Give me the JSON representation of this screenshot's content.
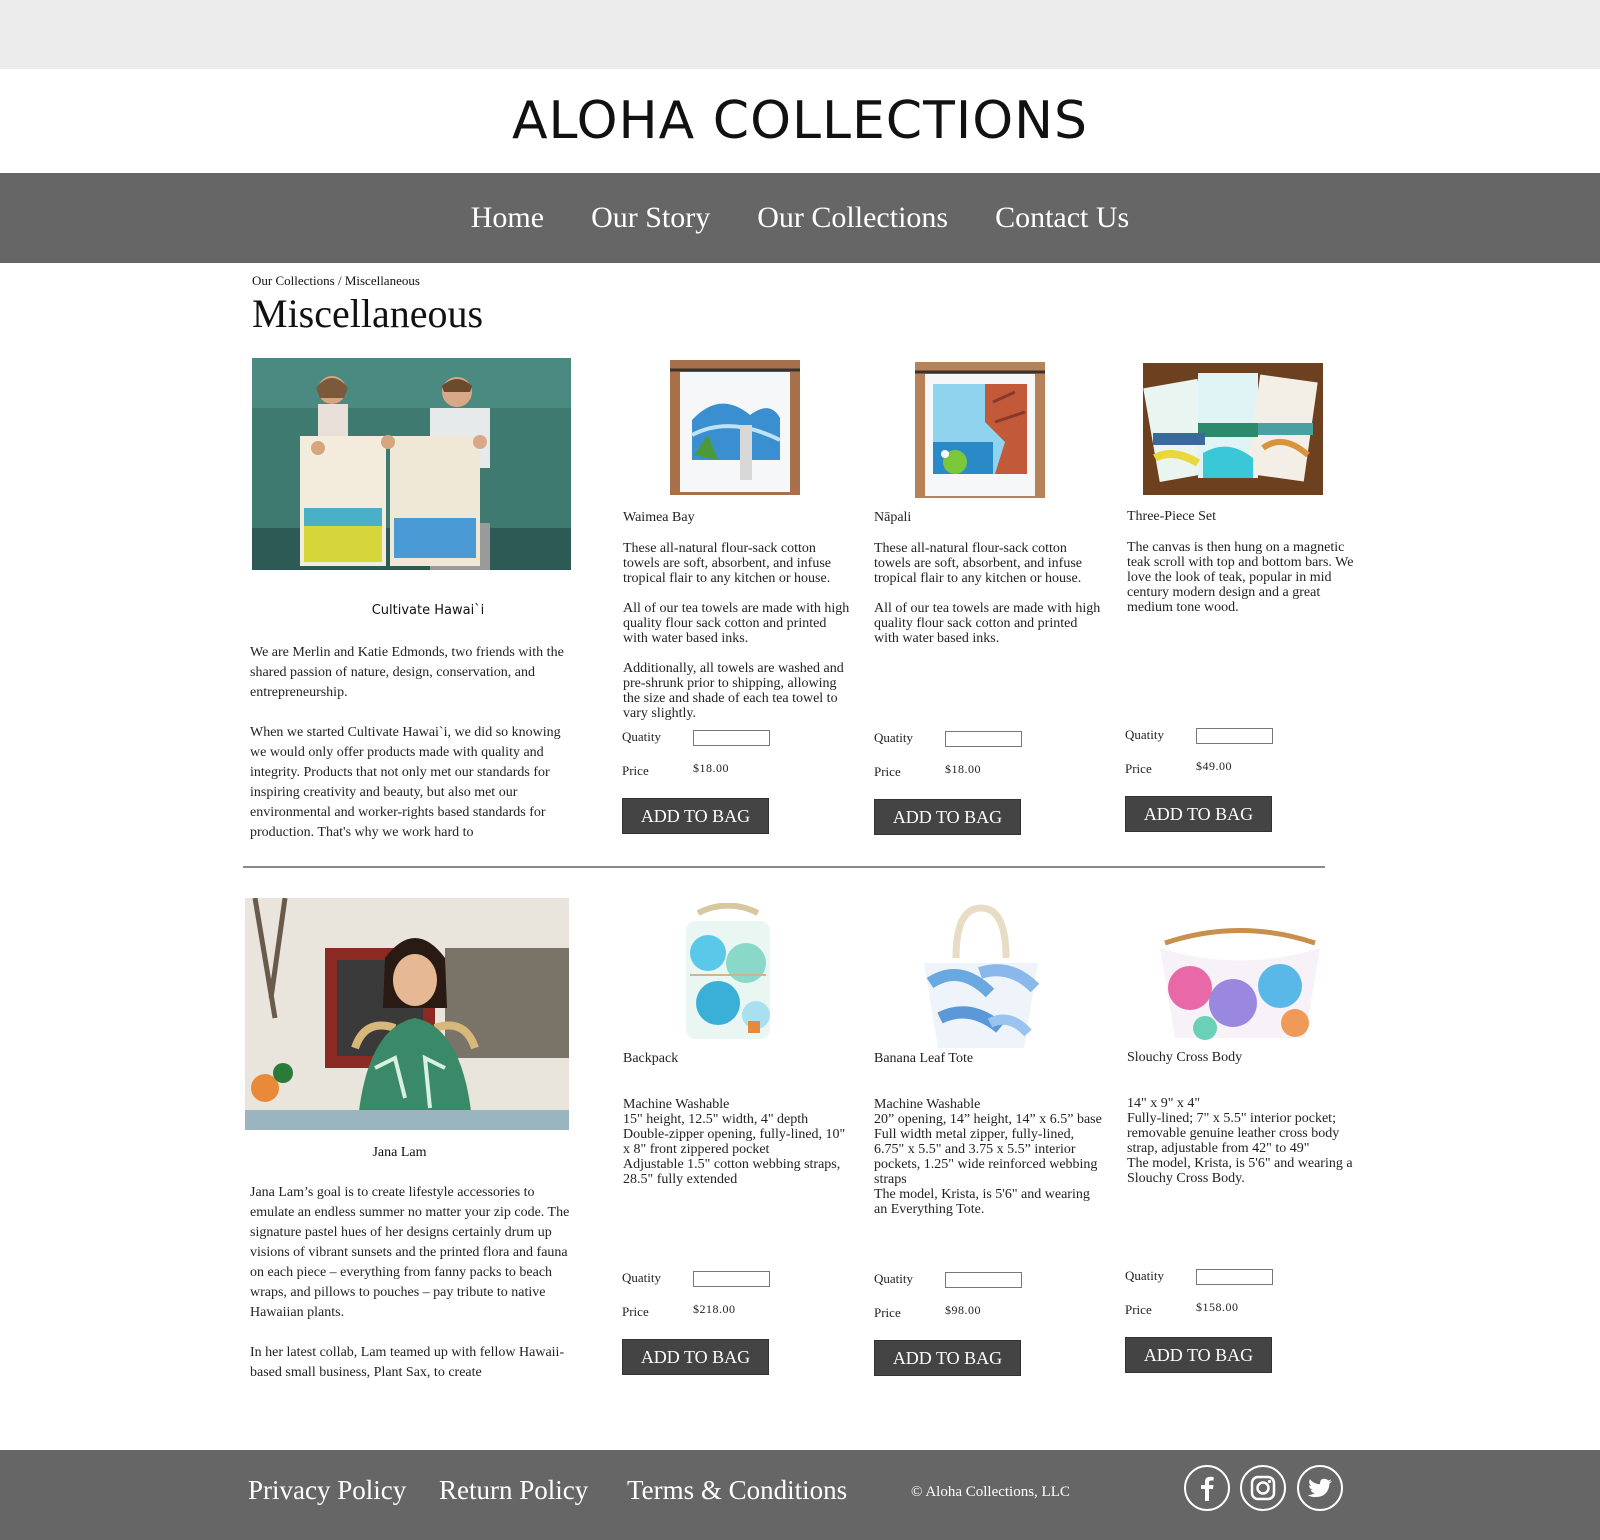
{
  "brand": {
    "logo_text": "ALOHA COLLECTIONS"
  },
  "nav": {
    "items": [
      {
        "label": "Home"
      },
      {
        "label": "Our Story"
      },
      {
        "label": "Our Collections"
      },
      {
        "label": "Contact Us"
      }
    ]
  },
  "breadcrumb": {
    "parent": "Our Collections",
    "separator": "/",
    "current": "Miscellaneous"
  },
  "page_title": "Miscellaneous",
  "sections": [
    {
      "photo_icon": "couple-holding-tea-towels-photo",
      "caption": "Cultivate Hawai`i",
      "bio": [
        "We are Merlin and Katie Edmonds, two friends with the shared passion of nature, design, conservation, and entrepreneurship.",
        "When we started Cultivate Hawai`i, we did so knowing we would only offer products made with quality and integrity. Products that not only met our standards for inspiring creativity and beauty, but also met our environmental and worker-rights based standards for production. That's why we work hard to"
      ],
      "products": [
        {
          "name": "Waimea Bay",
          "image_icon": "waimea-bay-tea-towel-image",
          "description": [
            "These all-natural flour-sack cotton towels are soft, absorbent, and infuse tropical flair to any kitchen or house.",
            "All of our tea towels are made with high quality flour sack cotton and printed with water based inks.",
            "Additionally, all towels are washed and pre-shrunk prior to shipping, allowing the size and shade of each tea towel to vary slightly."
          ],
          "qty_label": "Quatity",
          "qty_value": "",
          "price_label": "Price",
          "price": "$18.00",
          "button": "ADD TO BAG"
        },
        {
          "name": "Nāpali",
          "image_icon": "napali-tea-towel-image",
          "description": [
            "These all-natural flour-sack cotton towels are soft, absorbent, and infuse tropical flair to any kitchen or house.",
            "All of our tea towels are made with high quality flour sack cotton and printed with water based inks."
          ],
          "qty_label": "Quatity",
          "qty_value": "",
          "price_label": "Price",
          "price": "$18.00",
          "button": "ADD TO BAG"
        },
        {
          "name": "Three-Piece Set",
          "image_icon": "three-piece-set-image",
          "description": [
            "The canvas is then hung on a magnetic teak scroll with top and bottom bars.  We love the look of teak, popular in mid century modern design and a great medium tone wood."
          ],
          "qty_label": "Quatity",
          "qty_value": "",
          "price_label": "Price",
          "price": "$49.00",
          "button": "ADD TO BAG"
        }
      ]
    },
    {
      "photo_icon": "jana-lam-portrait-photo",
      "caption": "Jana Lam",
      "bio": [
        "Jana Lam’s goal is to create lifestyle accessories to emulate an endless summer no matter your zip code. The signature pastel hues of her designs certainly drum up visions of vibrant sunsets and the printed flora and fauna on each piece – everything from fanny packs to beach wraps, and pillows to pouches – pay tribute to native Hawaiian plants.",
        "In her latest collab, Lam teamed up with fellow Hawaii-based small business, Plant Sax, to create"
      ],
      "products": [
        {
          "name": "Backpack",
          "image_icon": "backpack-image",
          "description": [
            "Machine Washable\n15\" height, 12.5\" width, 4\" depth\nDouble-zipper opening, fully-lined, 10\" x 8\" front zippered pocket\nAdjustable 1.5\" cotton webbing straps, 28.5\" fully extended"
          ],
          "qty_label": "Quatity",
          "qty_value": "",
          "price_label": "Price",
          "price": "$218.00",
          "button": "ADD TO BAG"
        },
        {
          "name": "Banana Leaf Tote",
          "image_icon": "banana-leaf-tote-image",
          "description": [
            "Machine Washable\n20” opening, 14” height, 14” x 6.5” base\nFull width metal zipper, fully-lined, 6.75\" x 5.5\" and 3.75 x 5.5” interior pockets, 1.25\" wide reinforced webbing straps\nThe model, Krista, is 5'6\" and wearing an Everything Tote."
          ],
          "qty_label": "Quatity",
          "qty_value": "",
          "price_label": "Price",
          "price": "$98.00",
          "button": "ADD TO BAG"
        },
        {
          "name": "Slouchy Cross Body",
          "image_icon": "slouchy-cross-body-image",
          "description": [
            "14\" x 9\" x 4\"\nFully-lined; 7\" x 5.5\" interior pocket; removable genuine leather cross body strap, adjustable from 42\" to 49\"\nThe model, Krista, is 5'6\" and wearing a Slouchy Cross Body."
          ],
          "qty_label": "Quatity",
          "qty_value": "",
          "price_label": "Price",
          "price": "$158.00",
          "button": "ADD TO BAG"
        }
      ]
    }
  ],
  "footer": {
    "links": [
      {
        "label": "Privacy Policy"
      },
      {
        "label": "Return Policy"
      },
      {
        "label": "Terms & Conditions"
      }
    ],
    "copyright": "© Aloha Collections, LLC",
    "social": [
      {
        "icon": "facebook-icon"
      },
      {
        "icon": "instagram-icon"
      },
      {
        "icon": "twitter-icon"
      }
    ]
  },
  "colors": {
    "nav_bg": "#666666",
    "topbar_bg": "#ececec",
    "button_bg": "#444444",
    "divider": "#8a8a8a"
  }
}
